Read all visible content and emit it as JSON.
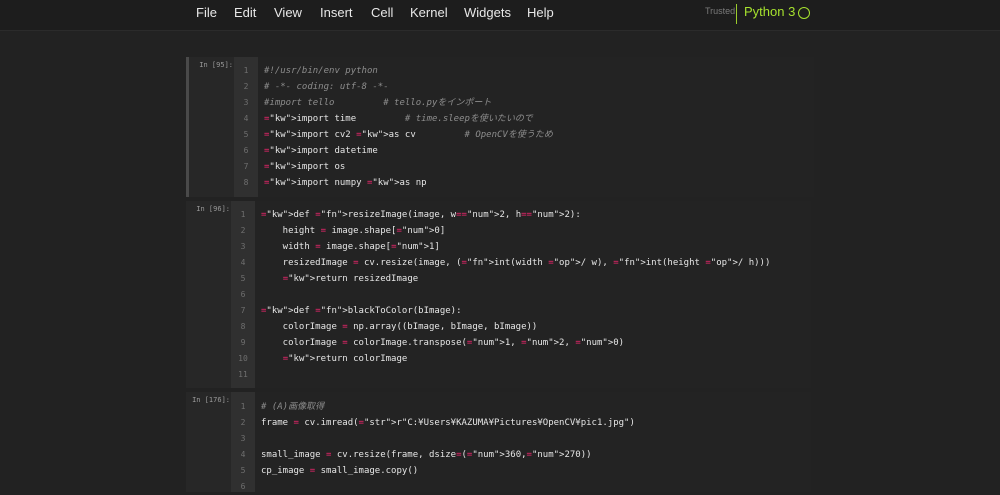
{
  "menu": [
    "File",
    "Edit",
    "View",
    "Insert",
    "Cell",
    "Kernel",
    "Widgets",
    "Help"
  ],
  "trusted_label": "Trusted",
  "kernel_name": "Python 3",
  "cells": [
    {
      "prompt": "In [95]:",
      "lines": [
        "#!/usr/bin/env python",
        "# -*- coding: utf-8 -*-",
        "#import tello         # tello.pyをインポート",
        "import time         # time.sleepを使いたいので",
        "import cv2 as cv         # OpenCVを使うため",
        "import datetime",
        "import os",
        "import numpy as np"
      ]
    },
    {
      "prompt": "In [96]:",
      "lines": [
        "def resizeImage(image, w=2, h=2):",
        "    height = image.shape[0]",
        "    width = image.shape[1]",
        "    resizedImage = cv.resize(image, (int(width / w), int(height / h)))",
        "    return resizedImage",
        "",
        "def blackToColor(bImage):",
        "    colorImage = np.array((bImage, bImage, bImage))",
        "    colorImage = colorImage.transpose(1, 2, 0)",
        "    return colorImage",
        ""
      ]
    },
    {
      "prompt": "In [176]:",
      "lines": [
        "# (A)画像取得",
        "frame = cv.imread(r\"C:¥Users¥KAZUMA¥Pictures¥OpenCV¥pic1.jpg\")",
        "",
        "small_image = cv.resize(frame, dsize=(360,270))",
        "cp_image = small_image.copy()",
        ""
      ]
    }
  ]
}
